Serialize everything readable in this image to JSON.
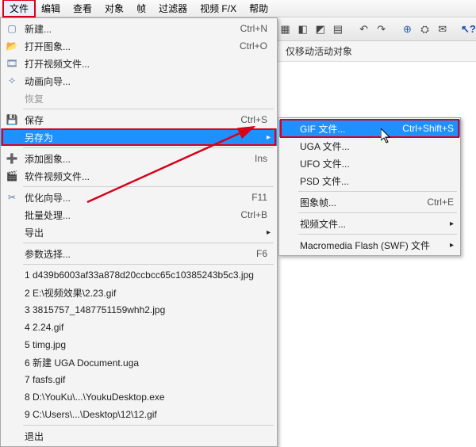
{
  "menubar": {
    "items": [
      "文件",
      "编辑",
      "查看",
      "对象",
      "帧",
      "过滤器",
      "视频 F/X",
      "帮助"
    ]
  },
  "subbar": {
    "text": "仅移动活动对象"
  },
  "fileMenu": {
    "new": "新建...",
    "new_key": "Ctrl+N",
    "open": "打开图象...",
    "open_key": "Ctrl+O",
    "open_video": "打开视频文件...",
    "anim_wizard": "动画向导...",
    "restore": "恢复",
    "save": "保存",
    "save_key": "Ctrl+S",
    "save_as": "另存为",
    "add_image": "添加图象...",
    "add_image_key": "Ins",
    "add_video": "软件视频文件...",
    "optimize": "优化向导...",
    "optimize_key": "F11",
    "batch": "批量处理...",
    "batch_key": "Ctrl+B",
    "export": "导出",
    "params": "参数选择...",
    "params_key": "F6",
    "recent": [
      "1 d439b6003af33a878d20ccbcc65c10385243b5c3.jpg",
      "2 E:\\视频效果\\2.23.gif",
      "3 3815757_1487751159whh2.jpg",
      "4 2.24.gif",
      "5 timg.jpg",
      "6 新建 UGA Document.uga",
      "7 fasfs.gif",
      "8 D:\\YouKu\\...\\YoukuDesktop.exe",
      "9 C:\\Users\\...\\Desktop\\12\\12.gif"
    ],
    "exit": "退出"
  },
  "saveAsSub": {
    "gif": "GIF 文件...",
    "gif_key": "Ctrl+Shift+S",
    "uga": "UGA 文件...",
    "ufo": "UFO 文件...",
    "psd": "PSD 文件...",
    "image_frames": "图象帧...",
    "image_frames_key": "Ctrl+E",
    "video": "视频文件...",
    "swf": "Macromedia Flash (SWF) 文件"
  }
}
